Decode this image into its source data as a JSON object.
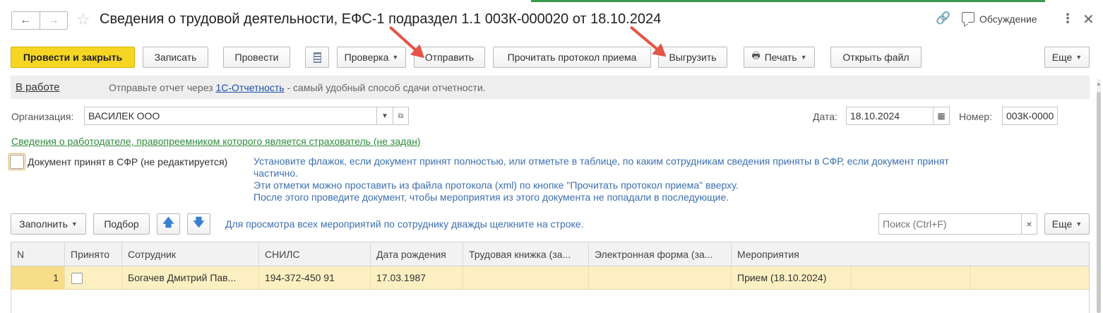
{
  "window": {
    "title": "Сведения о трудовой деятельности, ЕФС-1 подраздел 1.1 003К-000020 от 18.10.2024",
    "nav_back": "←",
    "nav_forward": "→",
    "discussion": "Обсуждение"
  },
  "toolbar": {
    "post_close": "Провести и закрыть",
    "save": "Записать",
    "post": "Провести",
    "check": "Проверка",
    "send": "Отправить",
    "read_protocol": "Прочитать протокол приема",
    "export": "Выгрузить",
    "print": "Печать",
    "open_file": "Открыть файл",
    "more": "Еще"
  },
  "infobar": {
    "status": "В работе",
    "text_before": "Отправьте отчет через ",
    "link": "1С-Отчетность",
    "text_after": " - самый удобный способ сдачи отчетности."
  },
  "form": {
    "org_label": "Организация:",
    "org_value": "ВАСИЛЕК ООО",
    "date_label": "Дата:",
    "date_value": "18.10.2024",
    "number_label": "Номер:",
    "number_value": "003К-0000",
    "employer_link": "Сведения о работодателе, правопреемником которого является страхователь (не задан)",
    "accepted_label": "Документ принят в СФР (не редактируется)",
    "accepted_checked": false,
    "hint_lines": [
      "Установите флажок, если документ принят полностью, или отметьте в таблице, по каким сотрудникам сведения приняты в СФР, если документ принят",
      "частично.",
      "Эти отметки можно проставить из файла протокола (xml) по кнопке \"Прочитать протокол приема\" вверху.",
      "После этого проведите документ, чтобы мероприятия из этого документа не попадали в последующие."
    ]
  },
  "table_toolbar": {
    "fill": "Заполнить",
    "pick": "Подбор",
    "hint": "Для просмотра всех мероприятий по сотруднику дважды щелкните на строке.",
    "search_placeholder": "Поиск (Ctrl+F)",
    "clear": "×",
    "more": "Еще"
  },
  "table": {
    "columns": [
      "N",
      "Принято",
      "Сотрудник",
      "СНИЛС",
      "Дата рождения",
      "Трудовая книжка (за...",
      "Электронная форма (за...",
      "Мероприятия"
    ],
    "rows": [
      {
        "n": "1",
        "accepted": false,
        "employee": "Богачев Дмитрий Пав...",
        "snils": "194-372-450 91",
        "birth": "17.03.1987",
        "book": "",
        "eform": "",
        "events": "Прием (18.10.2024)"
      }
    ]
  },
  "colors": {
    "primary_button": "#f6d623",
    "arrow": "#e35547",
    "selected_row": "#fcf0c2",
    "hint_text": "#3c6fb0",
    "green_link": "#2e8b3e"
  }
}
